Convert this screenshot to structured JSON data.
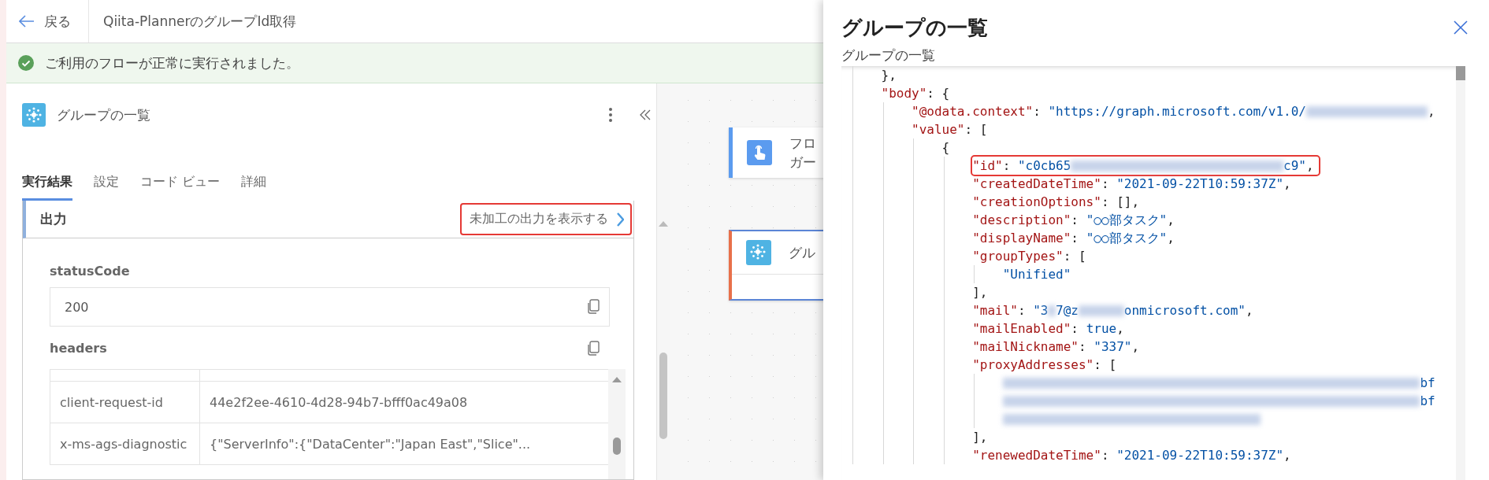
{
  "top_bar": {
    "back_label": "戻る",
    "title": "Qiita-PlannerのグループId取得"
  },
  "banner": {
    "message": "ご利用のフローが正常に実行されました。"
  },
  "action": {
    "title": "グループの一覧",
    "tabs": [
      {
        "label": "実行結果",
        "selected": true
      },
      {
        "label": "設定",
        "selected": false
      },
      {
        "label": "コード ビュー",
        "selected": false
      },
      {
        "label": "詳細",
        "selected": false
      }
    ],
    "output": {
      "title": "出力",
      "raw_link": {
        "label": "未加工の出力を表示する",
        "highlighted": true
      },
      "fields": [
        {
          "kind": "value",
          "label": "statusCode",
          "value": "200"
        },
        {
          "kind": "table",
          "label": "headers",
          "rows": [
            {
              "name": "client-request-id",
              "value": "44e2f2ee-4610-4d28-94b7-bfff0ac49a08"
            },
            {
              "name": "x-ms-ags-diagnostic",
              "value": "{\"ServerInfo\":{\"DataCenter\":\"Japan East\",\"Slice\"..."
            }
          ]
        }
      ]
    }
  },
  "canvas": {
    "cards": [
      {
        "kind": "trigger",
        "lines": [
          "フロ",
          "ガー"
        ],
        "selected": false
      },
      {
        "kind": "action",
        "lines": [
          "グル"
        ],
        "selected": true
      }
    ]
  },
  "details": {
    "title": "グループの一覧",
    "subtitle": "グループの一覧",
    "code_lines": [
      {
        "highlighted": false,
        "segments": [
          {
            "kind": "punct",
            "text": "},"
          }
        ]
      },
      {
        "highlighted": false,
        "segments": [
          {
            "kind": "key",
            "text": "\"body\""
          },
          {
            "kind": "punct",
            "text": ": {"
          }
        ],
        "children": [
          {
            "highlighted": false,
            "segments": [
              {
                "kind": "key",
                "text": "\"@odata.context\""
              },
              {
                "kind": "punct",
                "text": ": "
              },
              {
                "kind": "str",
                "text": "\"https://graph.microsoft.com/v1.0/"
              },
              {
                "kind": "redacted-medium"
              },
              {
                "kind": "punct",
                "text": ","
              }
            ]
          },
          {
            "highlighted": false,
            "segments": [
              {
                "kind": "key",
                "text": "\"value\""
              },
              {
                "kind": "punct",
                "text": ": ["
              }
            ],
            "children": [
              {
                "highlighted": false,
                "segments": [
                  {
                    "kind": "punct",
                    "text": "{"
                  }
                ],
                "children": [
                  {
                    "highlighted": true,
                    "segments": [
                      {
                        "kind": "key",
                        "text": "\"id\""
                      },
                      {
                        "kind": "punct",
                        "text": ": "
                      },
                      {
                        "kind": "str",
                        "text": "\"c0cb65"
                      },
                      {
                        "kind": "redacted-long"
                      },
                      {
                        "kind": "str",
                        "text": "c9\""
                      },
                      {
                        "kind": "punct",
                        "text": ","
                      }
                    ]
                  },
                  {
                    "highlighted": false,
                    "segments": [
                      {
                        "kind": "key",
                        "text": "\"createdDateTime\""
                      },
                      {
                        "kind": "punct",
                        "text": ": "
                      },
                      {
                        "kind": "str",
                        "text": "\"2021-09-22T10:59:37Z\""
                      },
                      {
                        "kind": "punct",
                        "text": ","
                      }
                    ]
                  },
                  {
                    "highlighted": false,
                    "segments": [
                      {
                        "kind": "key",
                        "text": "\"creationOptions\""
                      },
                      {
                        "kind": "punct",
                        "text": ": [],"
                      }
                    ]
                  },
                  {
                    "highlighted": false,
                    "segments": [
                      {
                        "kind": "key",
                        "text": "\"description\""
                      },
                      {
                        "kind": "punct",
                        "text": ": "
                      },
                      {
                        "kind": "str",
                        "text": "\"○○部タスク\""
                      },
                      {
                        "kind": "punct",
                        "text": ","
                      }
                    ]
                  },
                  {
                    "highlighted": false,
                    "segments": [
                      {
                        "kind": "key",
                        "text": "\"displayName\""
                      },
                      {
                        "kind": "punct",
                        "text": ": "
                      },
                      {
                        "kind": "str",
                        "text": "\"○○部タスク\""
                      },
                      {
                        "kind": "punct",
                        "text": ","
                      }
                    ]
                  },
                  {
                    "highlighted": false,
                    "segments": [
                      {
                        "kind": "key",
                        "text": "\"groupTypes\""
                      },
                      {
                        "kind": "punct",
                        "text": ": ["
                      }
                    ],
                    "children": [
                      {
                        "highlighted": false,
                        "segments": [
                          {
                            "kind": "str",
                            "text": "\"Unified\""
                          }
                        ]
                      }
                    ]
                  },
                  {
                    "highlighted": false,
                    "segments": [
                      {
                        "kind": "punct",
                        "text": "],"
                      }
                    ]
                  },
                  {
                    "highlighted": false,
                    "segments": [
                      {
                        "kind": "key",
                        "text": "\"mail\""
                      },
                      {
                        "kind": "punct",
                        "text": ": "
                      },
                      {
                        "kind": "str",
                        "text": "\"3"
                      },
                      {
                        "kind": "redacted-tiny"
                      },
                      {
                        "kind": "str",
                        "text": "7@z"
                      },
                      {
                        "kind": "redacted-short"
                      },
                      {
                        "kind": "str",
                        "text": "onmicrosoft.com\""
                      },
                      {
                        "kind": "punct",
                        "text": ","
                      }
                    ]
                  },
                  {
                    "highlighted": false,
                    "segments": [
                      {
                        "kind": "key",
                        "text": "\"mailEnabled\""
                      },
                      {
                        "kind": "punct",
                        "text": ": "
                      },
                      {
                        "kind": "lit",
                        "text": "true"
                      },
                      {
                        "kind": "punct",
                        "text": ","
                      }
                    ]
                  },
                  {
                    "highlighted": false,
                    "segments": [
                      {
                        "kind": "key",
                        "text": "\"mailNickname\""
                      },
                      {
                        "kind": "punct",
                        "text": ": "
                      },
                      {
                        "kind": "str",
                        "text": "\"337\""
                      },
                      {
                        "kind": "punct",
                        "text": ","
                      }
                    ]
                  },
                  {
                    "highlighted": false,
                    "segments": [
                      {
                        "kind": "key",
                        "text": "\"proxyAddresses\""
                      },
                      {
                        "kind": "punct",
                        "text": ": ["
                      }
                    ],
                    "children": [
                      {
                        "highlighted": false,
                        "segments": [
                          {
                            "kind": "redacted-wide"
                          },
                          {
                            "kind": "str",
                            "text": "bf"
                          }
                        ]
                      },
                      {
                        "highlighted": false,
                        "segments": [
                          {
                            "kind": "redacted-wide"
                          },
                          {
                            "kind": "str",
                            "text": "bf"
                          }
                        ]
                      },
                      {
                        "highlighted": false,
                        "segments": [
                          {
                            "kind": "redacted-line"
                          }
                        ]
                      }
                    ]
                  },
                  {
                    "highlighted": false,
                    "segments": [
                      {
                        "kind": "punct",
                        "text": "],"
                      }
                    ]
                  },
                  {
                    "highlighted": false,
                    "segments": [
                      {
                        "kind": "key",
                        "text": "\"renewedDateTime\""
                      },
                      {
                        "kind": "punct",
                        "text": ": "
                      },
                      {
                        "kind": "str",
                        "text": "\"2021-09-22T10:59:37Z\""
                      },
                      {
                        "kind": "punct",
                        "text": ","
                      }
                    ]
                  }
                ]
              }
            ]
          }
        ]
      }
    ]
  }
}
